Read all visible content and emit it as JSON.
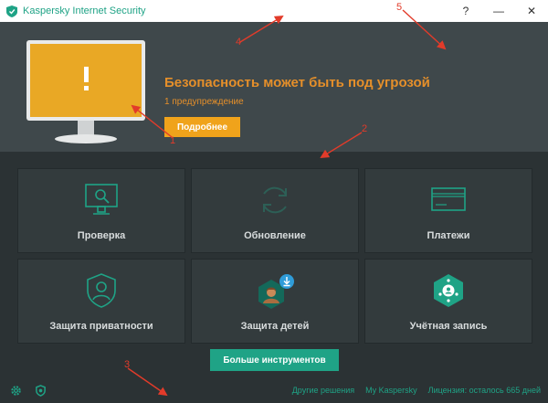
{
  "window": {
    "title": "Kaspersky Internet Security",
    "help": "?",
    "minimize": "—",
    "close": "✕"
  },
  "header": {
    "alert_title": "Безопасность может быть под угрозой",
    "alert_subtitle": "1 предупреждение",
    "details_button": "Подробнее"
  },
  "tiles": [
    {
      "label": "Проверка",
      "icon": "scan-monitor-icon"
    },
    {
      "label": "Обновление",
      "icon": "update-refresh-icon"
    },
    {
      "label": "Платежи",
      "icon": "payment-card-icon"
    },
    {
      "label": "Защита приватности",
      "icon": "privacy-shield-icon"
    },
    {
      "label": "Защита детей",
      "icon": "child-download-icon"
    },
    {
      "label": "Учётная запись",
      "icon": "account-network-icon"
    }
  ],
  "more_tools_button": "Больше инструментов",
  "footer": {
    "links": [
      "Другие решения",
      "My Kaspersky",
      "Лицензия: осталось 665 дней"
    ]
  },
  "annotations": [
    "1",
    "2",
    "3",
    "4",
    "5"
  ],
  "colors": {
    "accent_green": "#1fa386",
    "warning_orange": "#e58f2a",
    "button_orange": "#f0a31b",
    "annotation_red": "#e23b2a"
  }
}
